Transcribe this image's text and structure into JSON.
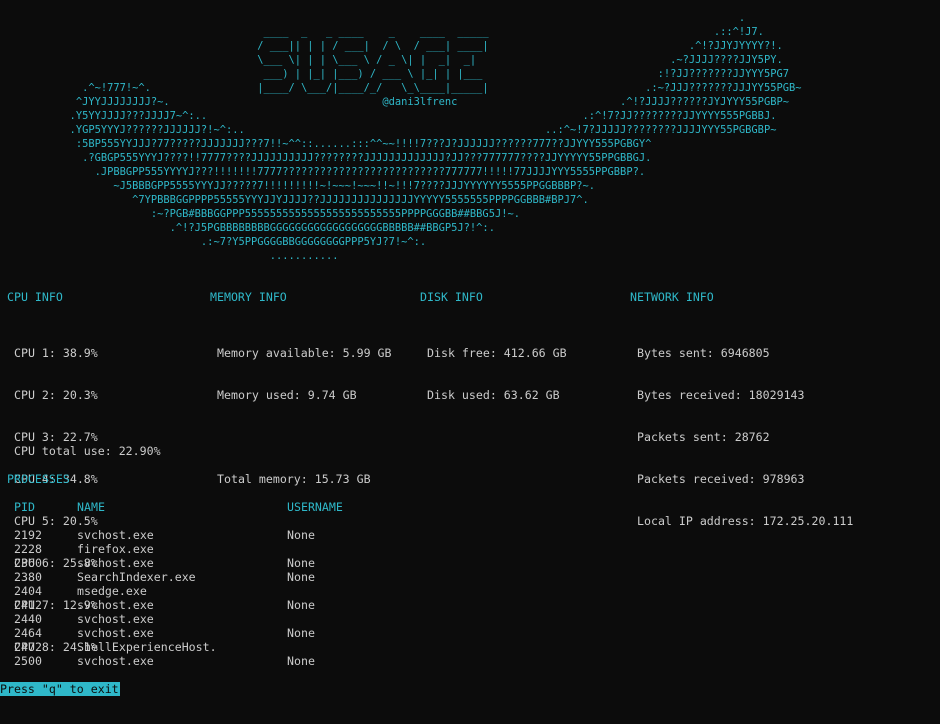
{
  "banner": {
    "ascii_art": "                                                                                                                     .\n                                         ____  _   _ ____    _    ____  _____                                    .::^!J7.\n                                        / ___|| | | / ___|  / \\  / ___| ____|                                .^!?JJYJYYYY?!.\n                                        \\___ \\| | | \\___ \\ / _ \\| |  _|  _|                               .~?JJJJ????JJY5PY.\n                                         ___) | |_| |___) / ___ \\ |_| | |___                            :!?JJ???????JJYYY5PG7\n            .^~!777!~^.                 |____/ \\___/|____/_/   \\_\\____|_____|                         .:~?JJJ???????JJJYY55PGB~\n           ^JYYJJJJJJJJ?~.                                  @dani3lfrenc                          .^!?JJJJ??????JYJYYY55PGBP~\n          .Y5YYJJJJ???JJJJ7~^:..                                                            .:^!7?JJ????????JJYYYY555PGBBJ.\n          .YGP5YYYJ??????JJJJJJ?!~^:..                                                ..:^~!7?JJJJJ????????JJJJYYY55PGBGBP~\n           :5BP555YYJJJ?77?????JJJJJJJ???7!!~^^::......:::^^~~!!!!7???J?JJJJJJ??????777??JJYYY555PGBGY^\n            .?GBGP555YYYJ????!!7777????JJJJJJJJJJ????????JJJJJJJJJJJJJ?JJ???777777????JJYYYYY55PPGBBGJ.\n              .JPBBGPP555YYYYJ???!!!!!!!7777??????????????????????????777777!!!!!77JJJJYYY5555PPGBBP?.\n                 ~J5BBBGPP5555YYYJJ?????7!!!!!!!!!~!~~~!~~~!!~!!!7????JJJYYYYYY5555PPGGBBBP?~.\n                    ^7YPBBBGGPPPP55555YYYJJYJJJJ??JJJJJJJJJJJJJJJYYYYY5555555PPPPGGBBB#BPJ7^.\n                       :~?PGB#BBBGGPPP5555555555555555555555555PPPPGGGBB##BBG5J!~.\n                          .^!?J5PGBBBBBBBBGGGGGGGGGGGGGGGGGGBBBBB##BBGP5J?!^:.\n                               .:~7?Y5PPGGGGBBGGGGGGGGPPP5YJ?7!~^:.\n                                          ..........."
  },
  "sections": {
    "cpu_title": "CPU INFO",
    "memory_title": "MEMORY INFO",
    "disk_title": "DISK INFO",
    "network_title": "NETWORK INFO"
  },
  "cpu": {
    "cores": [
      "CPU 1: 38.9%",
      "CPU 2: 20.3%",
      "CPU 3: 22.7%",
      "CPU 4: 34.8%",
      "CPU 5: 20.5%",
      "CPU 6: 25.8%",
      "CPU 7: 12.9%",
      "CPU 8: 24.1%"
    ],
    "total": "CPU total use: 22.90%"
  },
  "memory": {
    "available": "Memory available: 5.99 GB",
    "used": "Memory used: 9.74 GB",
    "total": "Total memory: 15.73 GB"
  },
  "disk": {
    "free": "Disk free: 412.66 GB",
    "used": "Disk used: 63.62 GB"
  },
  "network": {
    "bytes_sent": "Bytes sent: 6946805",
    "bytes_received": "Bytes received: 18029143",
    "packets_sent": "Packets sent: 28762",
    "packets_received": "Packets received: 978963",
    "local_ip": "Local IP address: 172.25.20.111"
  },
  "processes": {
    "title": "PROCESSES",
    "headers": {
      "pid": "PID",
      "name": "NAME",
      "username": "USERNAME"
    },
    "rows": [
      {
        "pid": "2192",
        "name": "svchost.exe",
        "username": "None"
      },
      {
        "pid": "2228",
        "name": "firefox.exe",
        "username": ""
      },
      {
        "pid": "2360",
        "name": "svchost.exe",
        "username": "None"
      },
      {
        "pid": "2380",
        "name": "SearchIndexer.exe",
        "username": "None"
      },
      {
        "pid": "2404",
        "name": "msedge.exe",
        "username": ""
      },
      {
        "pid": "2412",
        "name": "svchost.exe",
        "username": "None"
      },
      {
        "pid": "2440",
        "name": "svchost.exe",
        "username": ""
      },
      {
        "pid": "2464",
        "name": "svchost.exe",
        "username": "None"
      },
      {
        "pid": "2472",
        "name": "ShellExperienceHost.",
        "username": ""
      },
      {
        "pid": "2500",
        "name": "svchost.exe",
        "username": "None"
      }
    ]
  },
  "footer": {
    "hint": "Press \"q\" to exit"
  },
  "colors": {
    "background": "#0c0c0c",
    "text": "#cccccc",
    "accent": "#2fb8c9"
  }
}
